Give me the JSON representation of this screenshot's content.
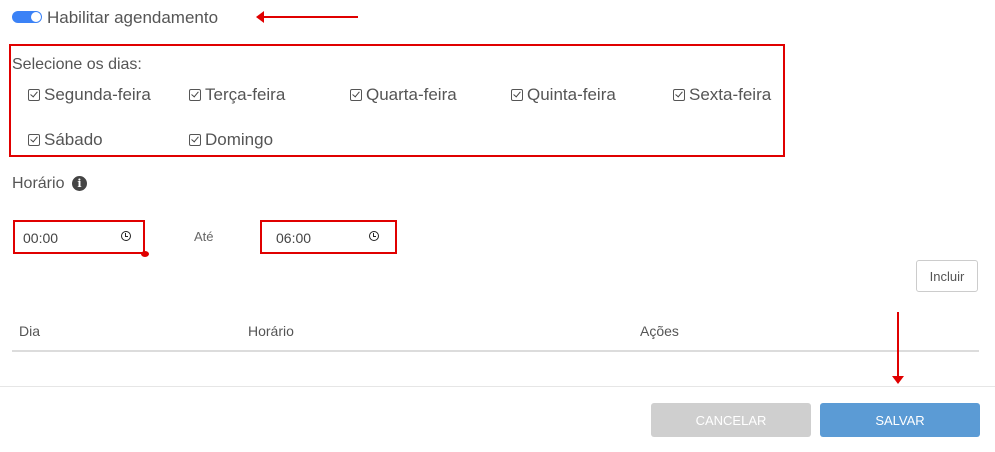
{
  "schedule": {
    "enable_label": "Habilitar agendamento",
    "enabled": true
  },
  "days": {
    "title": "Selecione os dias:",
    "items": [
      {
        "label": "Segunda-feira",
        "checked": true
      },
      {
        "label": "Terça-feira",
        "checked": true
      },
      {
        "label": "Quarta-feira",
        "checked": true
      },
      {
        "label": "Quinta-feira",
        "checked": true
      },
      {
        "label": "Sexta-feira",
        "checked": true
      },
      {
        "label": "Sábado",
        "checked": true
      },
      {
        "label": "Domingo",
        "checked": true
      }
    ]
  },
  "time": {
    "title": "Horário",
    "info_icon": "info-circle-icon",
    "start_value": "00:00",
    "separator_label": "Até",
    "end_value": "06:00"
  },
  "actions": {
    "include_label": "Incluir",
    "cancel_label": "CANCELAR",
    "save_label": "SALVAR"
  },
  "table": {
    "headers": [
      "Dia",
      "Horário",
      "Ações"
    ],
    "rows": []
  },
  "colors": {
    "accent": "#3b82f6",
    "save_button": "#5b9bd5",
    "cancel_button": "#cfcfcf",
    "annotation": "#e00000"
  }
}
